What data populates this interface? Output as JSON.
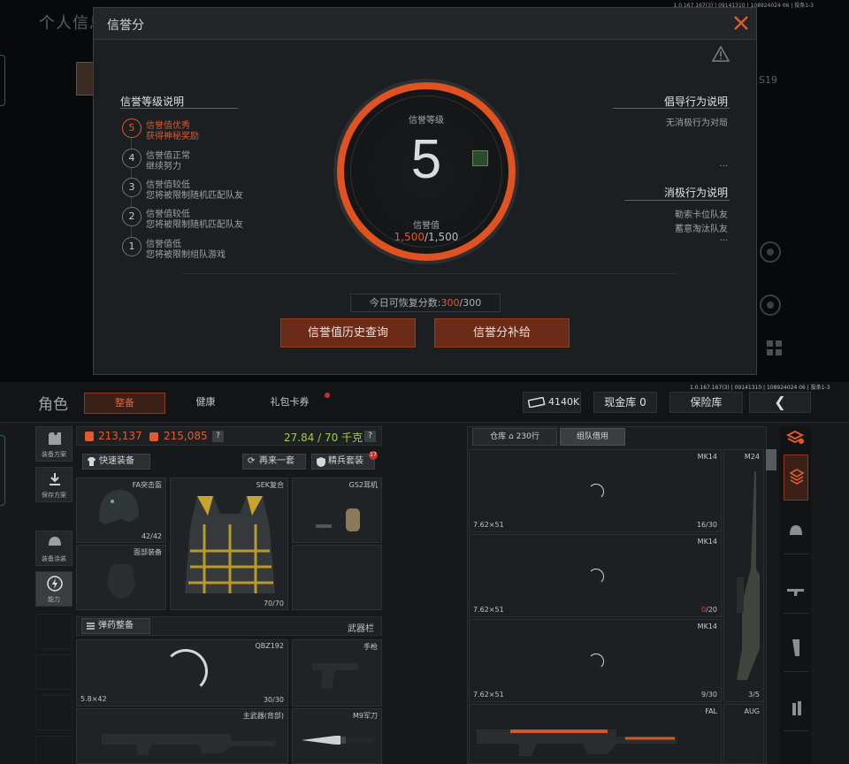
{
  "background": {
    "title": "个人信息",
    "version": "1.0.167.167(3) | 09141310 | 108924024 06 | 投条1-3",
    "tag": "S19"
  },
  "modal": {
    "title": "信誉分",
    "close_icon": "close-icon",
    "warning_icon": "warning-icon",
    "left_header": "信誉等级说明",
    "tiers": [
      {
        "num": "5",
        "line1": "信誉值优秀",
        "line2": "获得神秘奖励",
        "active": true
      },
      {
        "num": "4",
        "line1": "信誉值正常",
        "line2": "继续努力",
        "active": false
      },
      {
        "num": "3",
        "line1": "信誉值较低",
        "line2": "您将被限制随机匹配队友",
        "active": false
      },
      {
        "num": "2",
        "line1": "信誉值较低",
        "line2": "您将被限制随机匹配队友",
        "active": false
      },
      {
        "num": "1",
        "line1": "信誉值低",
        "line2": "您将被限制组队游戏",
        "active": false
      }
    ],
    "level_label": "信誉等级",
    "level": "5",
    "value_label": "信誉值",
    "value_current": "1,500",
    "value_max": "/1,500",
    "right_header1": "倡导行为说明",
    "right_items1": [
      "无消极行为对局",
      "..."
    ],
    "right_header2": "消极行为说明",
    "right_items2": [
      "勒索卡位队友",
      "蓄意淘汰队友",
      "..."
    ],
    "today_label": "今日可恢复分数:",
    "today_value": "300",
    "today_max": "/300",
    "btn_history": "信誉值历史查询",
    "btn_supply": "信誉分补给",
    "colors": {
      "accent": "#e0521f",
      "button_bg": "#6b2b18"
    }
  },
  "bottom": {
    "version": "1.0.167.167(3) | 09141310 | 108924024 06 | 投条1-3",
    "role_title": "角色",
    "tabs": [
      "整备",
      "健康",
      "礼包卡券"
    ],
    "currency": "4140K",
    "cash_vault": "现金库 0",
    "safe_box": "保险库",
    "back_icon": "chevron-left-icon",
    "side_buttons": [
      "装备方案",
      "保存方案",
      "装备涂装",
      "能力"
    ],
    "value_1": "213,137",
    "value_2": "215,085",
    "weight": "27.84 / 70 千克",
    "qmark": "?",
    "quick_equip": "快速装备",
    "again": "再来一套",
    "elite": "精兵套装",
    "elite_badge": "17",
    "slots": {
      "helmet": {
        "name": "FA突击盔",
        "count": "42/42"
      },
      "armor": {
        "name": "SEK复合",
        "count": "70/70"
      },
      "headset": {
        "name": "GS2耳机"
      },
      "face": {
        "name": "面部装备"
      }
    },
    "ammo_equip": "弹药整备",
    "weapon_bar": "武器栏",
    "primary": {
      "name": "QBZ192",
      "caliber": "5.8×42",
      "count": "30/30"
    },
    "pistol": {
      "name": "手枪"
    },
    "primary_back": "主武器(背部)",
    "knife": {
      "name": "M9军刀"
    },
    "stash_tab": "仓库",
    "stash_count": "230行",
    "team_tab": "组队借用",
    "stash_rows": [
      {
        "name": "MK14",
        "caliber": "7.62×51",
        "count": "16/30",
        "count_red": ""
      },
      {
        "name": "MK14",
        "caliber": "7.62×51",
        "count": "/20",
        "count_red": "0"
      },
      {
        "name": "MK14",
        "caliber": "7.62×51",
        "count": "9/30",
        "count_red": ""
      }
    ],
    "sniper": {
      "name": "M24",
      "count": "3/5"
    },
    "bottom_guns": [
      "FAL",
      "AUG"
    ],
    "colors": {
      "red": "#e55a2b",
      "green": "#a4c94a"
    }
  }
}
